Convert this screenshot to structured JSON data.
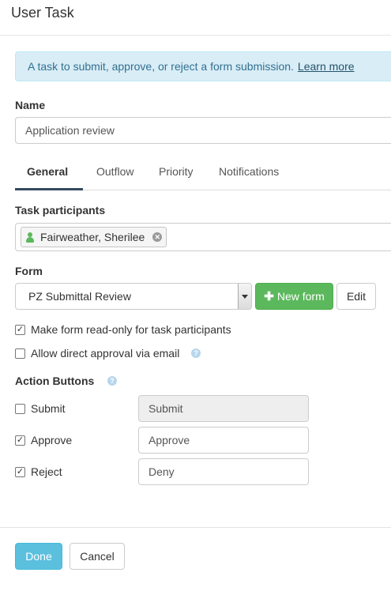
{
  "dialog": {
    "title": "User Task"
  },
  "info": {
    "text": "A task to submit, approve, or reject a form submission.",
    "link": "Learn more"
  },
  "name": {
    "label": "Name",
    "value": "Application review"
  },
  "tabs": [
    {
      "label": "General",
      "active": true
    },
    {
      "label": "Outflow",
      "active": false
    },
    {
      "label": "Priority",
      "active": false
    },
    {
      "label": "Notifications",
      "active": false
    }
  ],
  "participants": {
    "label": "Task participants",
    "chip": "Fairweather, Sherilee"
  },
  "form": {
    "label": "Form",
    "selected": "PZ Submittal Review",
    "new_button": "New form",
    "edit_button": "Edit"
  },
  "options": {
    "read_only": {
      "label": "Make form read-only for task participants",
      "checked": true
    },
    "direct_approval": {
      "label": "Allow direct approval via email",
      "checked": false
    }
  },
  "action_buttons": {
    "label": "Action Buttons",
    "items": [
      {
        "label": "Submit",
        "checked": false,
        "value": "Submit",
        "disabled": true
      },
      {
        "label": "Approve",
        "checked": true,
        "value": "Approve",
        "disabled": false
      },
      {
        "label": "Reject",
        "checked": true,
        "value": "Deny",
        "disabled": false
      }
    ]
  },
  "footer": {
    "done": "Done",
    "cancel": "Cancel"
  },
  "colors": {
    "info_bg": "#d9edf7",
    "info_text": "#31708f",
    "green": "#5cb85c",
    "done": "#5bc0de",
    "tab_active": "#34495e"
  }
}
